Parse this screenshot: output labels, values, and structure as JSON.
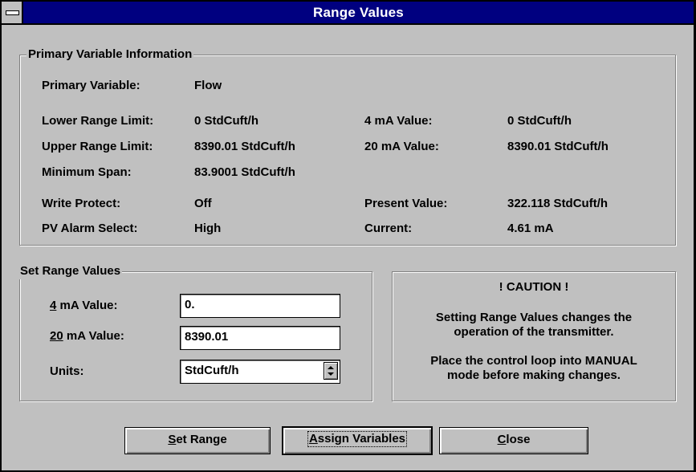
{
  "window": {
    "title": "Range Values"
  },
  "primary_info": {
    "group_label": "Primary Variable Information",
    "primary_variable": {
      "label": "Primary Variable:",
      "value": "Flow"
    },
    "lower_range_limit": {
      "label": "Lower Range Limit:",
      "value": "0 StdCuft/h"
    },
    "upper_range_limit": {
      "label": "Upper Range Limit:",
      "value": "8390.01 StdCuft/h"
    },
    "minimum_span": {
      "label": "Minimum Span:",
      "value": "83.9001 StdCuft/h"
    },
    "write_protect": {
      "label": "Write Protect:",
      "value": "Off"
    },
    "pv_alarm_select": {
      "label": "PV Alarm Select:",
      "value": "High"
    },
    "four_ma_value": {
      "label": "4 mA Value:",
      "value": "0 StdCuft/h"
    },
    "twenty_ma_value": {
      "label": "20 mA Value:",
      "value": "8390.01 StdCuft/h"
    },
    "present_value": {
      "label": "Present Value:",
      "value": "322.118 StdCuft/h"
    },
    "current": {
      "label": "Current:",
      "value": "4.61 mA"
    }
  },
  "set_range": {
    "group_label": "Set Range Values",
    "four_ma": {
      "label_hotkey": "4",
      "label_rest": " mA Value:",
      "value": "0."
    },
    "twenty_ma": {
      "label_hotkey": "20",
      "label_rest": " mA Value:",
      "value": "8390.01"
    },
    "units": {
      "label": "Units:",
      "value": "StdCuft/h"
    }
  },
  "caution": {
    "heading": "! CAUTION !",
    "line1": "Setting Range Values changes the",
    "line2": "operation of the transmitter.",
    "line3": "Place the control loop into MANUAL",
    "line4": "mode before making changes."
  },
  "buttons": {
    "set_range": {
      "hotkey": "S",
      "rest": "et Range"
    },
    "assign_variables": {
      "hotkey": "A",
      "rest": "ssign Variables"
    },
    "close": {
      "hotkey": "C",
      "rest": "lose"
    }
  }
}
